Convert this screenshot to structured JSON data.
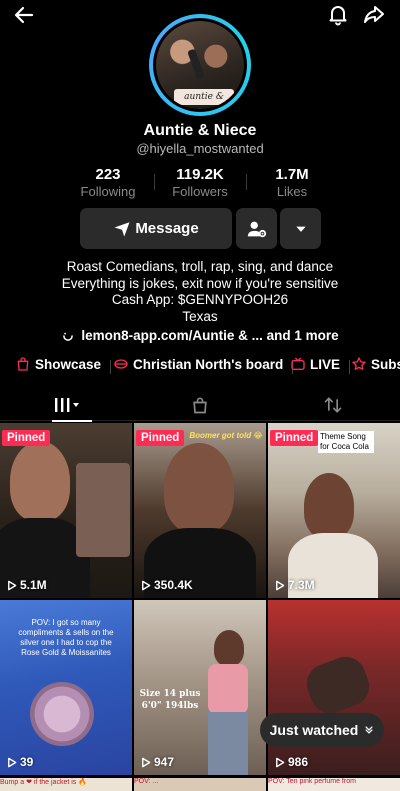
{
  "header": {
    "back_icon": "arrow-left-icon",
    "bell_icon": "bell-icon",
    "share_icon": "share-arrow-icon"
  },
  "profile": {
    "avatar_logo_text": "auntie & niece",
    "name": "Auntie & Niece",
    "handle": "@hiyella_mostwanted",
    "ring_color": "#2ec5f2"
  },
  "stats": [
    {
      "value": "223",
      "label": "Following"
    },
    {
      "value": "119.2K",
      "label": "Followers"
    },
    {
      "value": "1.7M",
      "label": "Likes"
    }
  ],
  "actions": {
    "message_label": "Message",
    "follow_options_icon": "user-gear-icon",
    "more_icon": "caret-down-icon"
  },
  "bio": {
    "line1": "Roast Comedians, troll, rap, sing, and dance",
    "line2": "Everything is jokes, exit now if you're sensitive",
    "line3": "Cash App: $GENNYPOOH26",
    "line4": "Texas",
    "link": "lemon8-app.com/Auntie & ... and 1 more"
  },
  "pills": [
    {
      "label": "Showcase",
      "icon": "bag-icon"
    },
    {
      "label": "Christian North's board",
      "icon": "lips-icon"
    },
    {
      "label": "LIVE",
      "icon": "live-tv-icon"
    },
    {
      "label": "Subs",
      "icon": "star-icon"
    }
  ],
  "tabs": [
    {
      "name": "videos",
      "icon": "grid-icon"
    },
    {
      "name": "private",
      "icon": "lock-bag-icon"
    },
    {
      "name": "reposts",
      "icon": "repost-icon"
    }
  ],
  "videos": [
    {
      "pinned": "Pinned",
      "views": "5.1M"
    },
    {
      "pinned": "Pinned",
      "views": "350.4K",
      "caption": "Boomer got told 😂"
    },
    {
      "pinned": "Pinned",
      "views": "7.3M",
      "caption": "Theme Song for Coca Cola"
    },
    {
      "views": "39",
      "caption": "POV: I got so many compliments & sells on the silver one I had to cop the Rose Gold & Moissanites"
    },
    {
      "views": "947",
      "caption": "Size 14 plus 6'0\" 194lbs"
    },
    {
      "views": "986"
    }
  ],
  "bottom_captions": [
    "Bump a ❤ if the jacket is 🔥",
    "POV: ...",
    "POV: Ten pink perfume from"
  ],
  "just_watched": "Just watched",
  "brand_color": "#fe2c55"
}
